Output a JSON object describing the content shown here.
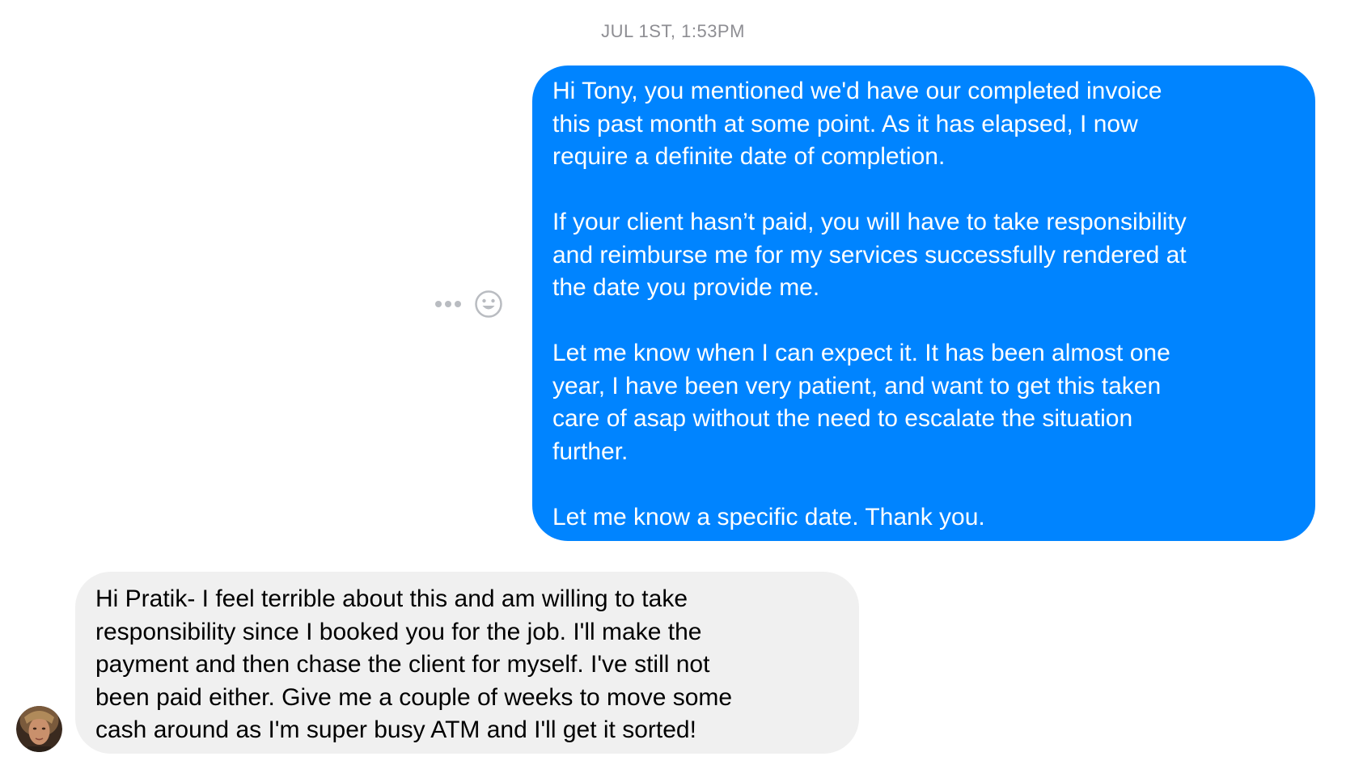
{
  "conversation": {
    "timestamp": "JUL 1ST, 1:53PM",
    "messages": [
      {
        "direction": "outgoing",
        "text": "Hi Tony, you mentioned we'd have our completed invoice\nthis past month at some point. As it has elapsed, I now\nrequire a definite date of completion.\n\nIf your client hasn’t paid, you will have to take responsibility\nand reimburse me for my services successfully rendered at\nthe date you provide me.\n\nLet me know when I can expect it. It has been almost one\nyear, I have been very patient, and want to get this taken\ncare of asap without the need to escalate the situation\nfurther.\n\nLet me know a specific date. Thank you."
      },
      {
        "direction": "incoming",
        "text": "Hi Pratik- I feel terrible about this and am willing to take\nresponsibility since I booked you for the job. I'll make the\npayment and then chase the client for myself. I've still not\nbeen paid either. Give me a couple of weeks to move some\ncash around as I'm super busy ATM and I'll get it sorted!"
      }
    ]
  },
  "icons": {
    "more": "more-options-icon",
    "react": "emoji-react-icon",
    "avatar": "contact-avatar"
  },
  "colors": {
    "outgoing_bubble": "#0084ff",
    "incoming_bubble": "#f0f0f0",
    "timestamp_text": "#8e8e93",
    "action_icons": "#b9bcc1"
  }
}
